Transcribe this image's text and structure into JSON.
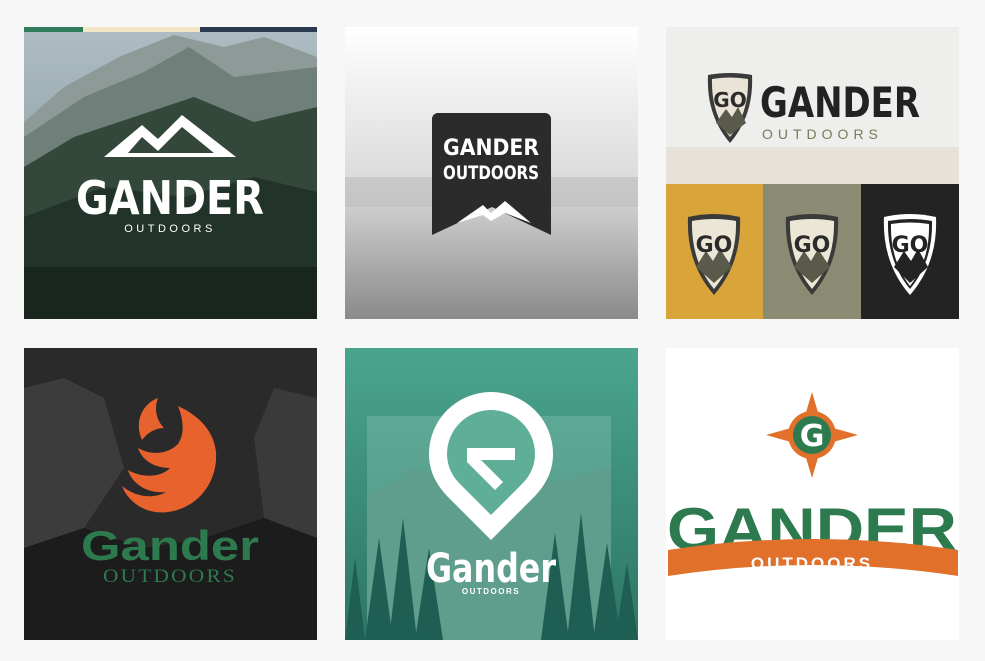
{
  "tiles": [
    {
      "wordmark": "GANDER",
      "tagline": "OUTDOORS"
    },
    {
      "wordmark": "GANDER",
      "tagline": "OUTDOORS"
    },
    {
      "wordmark": "GANDER",
      "tagline": "OUTDOORS",
      "badge": "GO"
    },
    {
      "wordmark": "Gander",
      "tagline": "OUTDOORS"
    },
    {
      "wordmark": "Gander",
      "tagline": "OUTDOORS"
    },
    {
      "wordmark": "GANDER",
      "tagline": "OUTDOORS",
      "monogram": "G"
    }
  ],
  "colors": {
    "stripe_green": "#2f7d5b",
    "stripe_cream": "#f3e6c8",
    "stripe_navy": "#2c3a4f",
    "gold": "#d9a53a",
    "olive": "#8b8a73",
    "charcoal": "#232323",
    "flame_orange": "#e8622e",
    "gander_green": "#2d7a4f",
    "compass_orange": "#e0702a",
    "teal": "#3f9a86"
  }
}
